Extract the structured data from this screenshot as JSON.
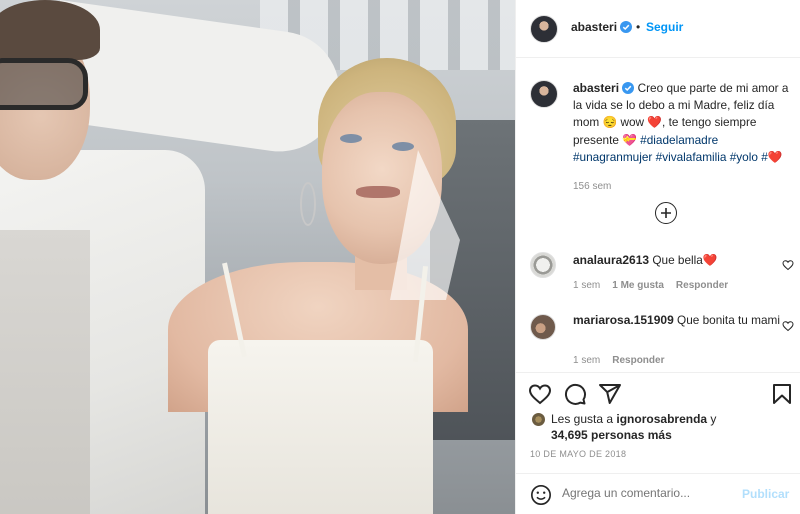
{
  "post": {
    "username": "abasteri",
    "follow_label": "Seguir",
    "dot": "•",
    "caption": {
      "text": "Creo que parte de mi amor a la vida se lo debo a mi Madre, feliz día mom 😔 wow ❤️, te tengo siempre presente 💝",
      "hashtags": "#diadelamadre #unagranmujer #vivalafamilia #yolo #❤️",
      "time": "156 sem"
    },
    "comments": [
      {
        "username": "analaura2613",
        "text": "Que bella❤️",
        "time": "1 sem",
        "likes": "1 Me gusta",
        "reply": "Responder"
      },
      {
        "username": "mariarosa.151909",
        "text": "Que bonita tu mami",
        "time": "1 sem",
        "reply": "Responder"
      }
    ],
    "likes": {
      "prefix": "Les gusta a",
      "first_user": "ignorosabrenda",
      "connector": "y",
      "count": "34,695 personas más"
    },
    "date": "10 DE MAYO DE 2018",
    "add_comment_placeholder": "Agrega un comentario...",
    "publish_label": "Publicar"
  },
  "icons": [
    "verified-icon",
    "heart-icon",
    "comment-icon",
    "share-icon",
    "bookmark-icon",
    "emoji-icon",
    "add-icon"
  ],
  "colors": {
    "accent": "#0095f6",
    "hashtag": "#00376b",
    "muted": "#8e8e8e",
    "publish_disabled": "#b2dffc",
    "heart": "#ed4956"
  }
}
